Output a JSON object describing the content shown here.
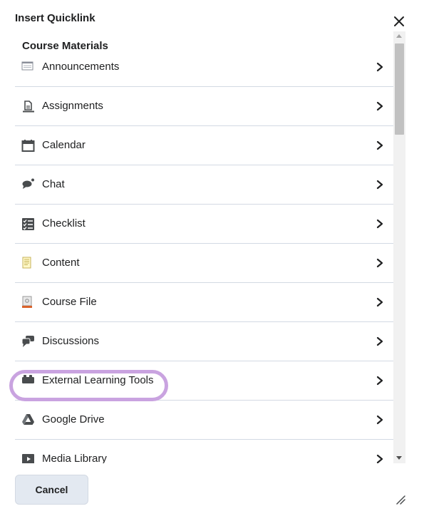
{
  "dialog": {
    "title": "Insert Quicklink",
    "close_icon": "close-icon",
    "cancel_label": "Cancel"
  },
  "section": {
    "title": "Course Materials"
  },
  "items": [
    {
      "label": "Announcements",
      "icon": "announcements-icon"
    },
    {
      "label": "Assignments",
      "icon": "assignments-icon"
    },
    {
      "label": "Calendar",
      "icon": "calendar-icon"
    },
    {
      "label": "Chat",
      "icon": "chat-icon"
    },
    {
      "label": "Checklist",
      "icon": "checklist-icon"
    },
    {
      "label": "Content",
      "icon": "content-icon"
    },
    {
      "label": "Course File",
      "icon": "course-file-icon"
    },
    {
      "label": "Discussions",
      "icon": "discussions-icon"
    },
    {
      "label": "External Learning Tools",
      "icon": "external-tools-icon",
      "highlighted": true
    },
    {
      "label": "Google Drive",
      "icon": "google-drive-icon"
    },
    {
      "label": "Media Library",
      "icon": "media-library-icon"
    }
  ],
  "colors": {
    "highlight": "#c9a3e0",
    "divider": "#d3d9e3",
    "button_bg": "#e3e9f1"
  }
}
